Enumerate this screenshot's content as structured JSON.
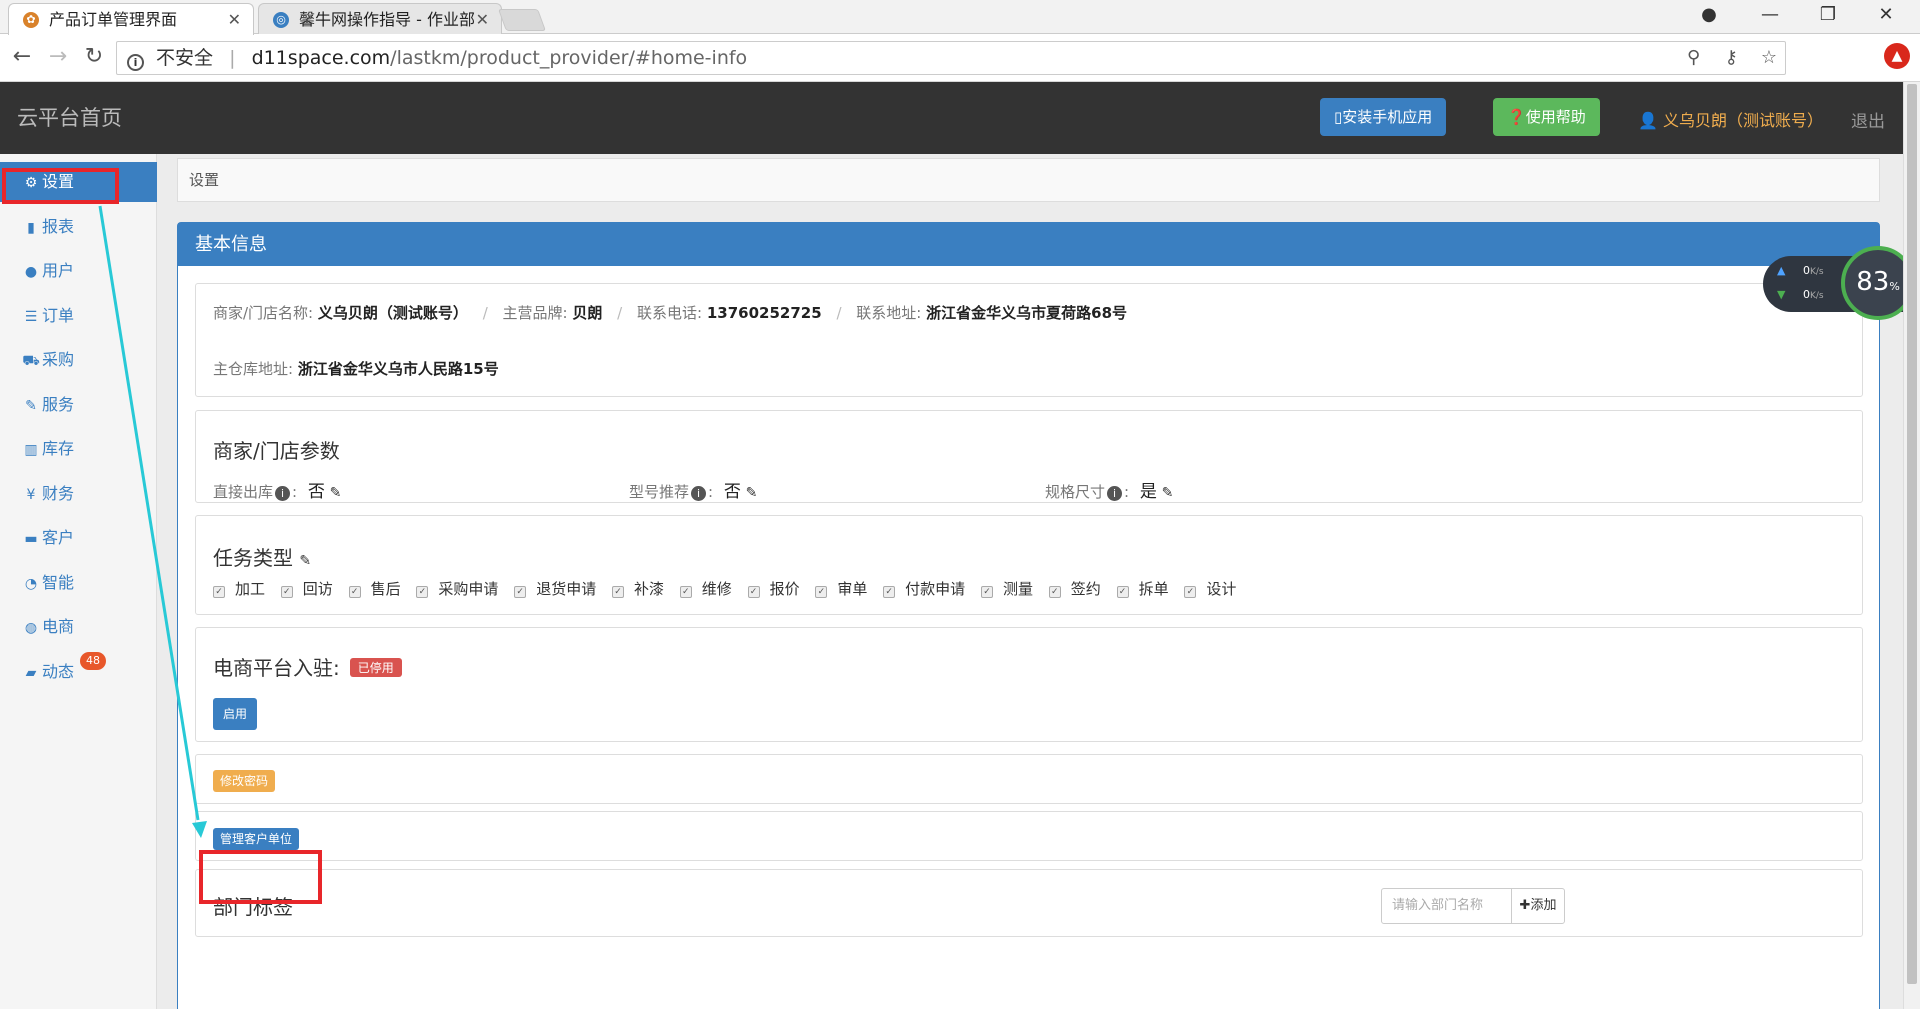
{
  "browser": {
    "tabs": [
      {
        "title": "产品订单管理界面",
        "active": true
      },
      {
        "title": "馨牛网操作指导 - 作业部",
        "active": false
      }
    ],
    "address": {
      "security": "不安全",
      "host": "d11space.com",
      "path": "/lastkm/product_provider/#home-info"
    }
  },
  "header": {
    "brand": "云平台首页",
    "install_app": "安装手机应用",
    "help": "使用帮助",
    "user": "义乌贝朗（测试账号）",
    "logout": "退出"
  },
  "sidebar": {
    "items": [
      {
        "label": "设置",
        "icon": "gear-icon"
      },
      {
        "label": "报表",
        "icon": "bar-chart-icon"
      },
      {
        "label": "用户",
        "icon": "user-icon"
      },
      {
        "label": "订单",
        "icon": "list-icon"
      },
      {
        "label": "采购",
        "icon": "cart-icon"
      },
      {
        "label": "服务",
        "icon": "wrench-icon"
      },
      {
        "label": "库存",
        "icon": "barcode-icon"
      },
      {
        "label": "财务",
        "icon": "yen-icon"
      },
      {
        "label": "客户",
        "icon": "briefcase-icon"
      },
      {
        "label": "智能",
        "icon": "dashboard-icon"
      },
      {
        "label": "电商",
        "icon": "globe-icon"
      },
      {
        "label": "动态",
        "icon": "comment-icon",
        "badge": "48"
      }
    ]
  },
  "breadcrumb": "设置",
  "panel": {
    "title": "基本信息",
    "basic": {
      "store_name_label": "商家/门店名称:",
      "store_name": "义乌贝朗（测试账号）",
      "brand_label": "主营品牌:",
      "brand": "贝朗",
      "phone_label": "联系电话:",
      "phone": "13760252725",
      "address_label": "联系地址:",
      "address": "浙江省金华义乌市夏荷路68号",
      "warehouse_label": "主仓库地址:",
      "warehouse": "浙江省金华义乌市人民路15号"
    },
    "params": {
      "title": "商家/门店参数",
      "direct_out_label": "直接出库",
      "direct_out": "否",
      "model_rec_label": "型号推荐",
      "model_rec": "否",
      "spec_size_label": "规格尺寸",
      "spec_size": "是"
    },
    "tasks": {
      "title": "任务类型",
      "items": [
        "加工",
        "回访",
        "售后",
        "采购申请",
        "退货申请",
        "补漆",
        "维修",
        "报价",
        "审单",
        "付款申请",
        "测量",
        "签约",
        "拆单",
        "设计"
      ]
    },
    "ecommerce": {
      "title": "电商平台入驻:",
      "status": "已停用",
      "enable_button": "启用"
    },
    "change_password": "修改密码",
    "manage_customers": "管理客户单位",
    "department": {
      "title": "部门标签",
      "placeholder": "请输入部门名称",
      "add": "添加"
    }
  },
  "netmon": {
    "up": "0",
    "down": "0",
    "unit": "K/s",
    "percent": "83",
    "percent_unit": "%"
  }
}
